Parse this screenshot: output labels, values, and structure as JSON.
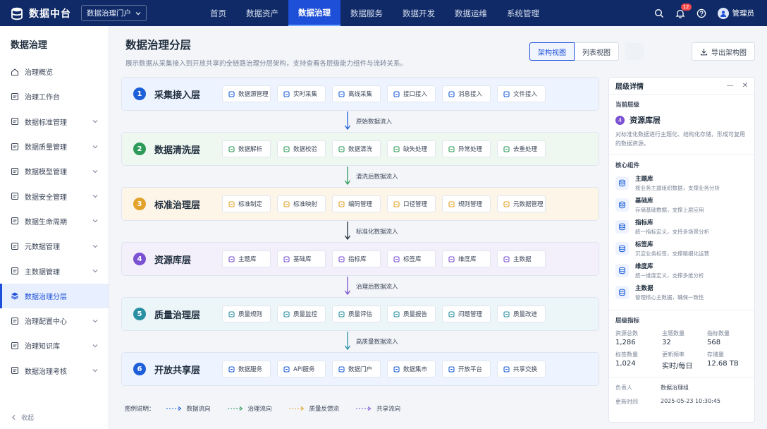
{
  "app": {
    "title": "数据中台",
    "portal": "数据治理门户"
  },
  "nav": [
    "首页",
    "数据资产",
    "数据治理",
    "数据服务",
    "数据开发",
    "数据运维",
    "系统管理"
  ],
  "nav_active": 2,
  "header": {
    "notif_count": "12",
    "user": "管理员"
  },
  "sidebar": {
    "title": "数据治理",
    "items": [
      {
        "label": "治理概览",
        "icon": "home-icon",
        "expand": false
      },
      {
        "label": "治理工作台",
        "icon": "workbench-icon",
        "expand": false
      },
      {
        "label": "数据标准管理",
        "icon": "standard-icon",
        "expand": true
      },
      {
        "label": "数据质量管理",
        "icon": "quality-icon",
        "expand": true
      },
      {
        "label": "数据模型管理",
        "icon": "model-icon",
        "expand": true
      },
      {
        "label": "数据安全管理",
        "icon": "security-icon",
        "expand": true
      },
      {
        "label": "数据生命周期",
        "icon": "lifecycle-icon",
        "expand": true
      },
      {
        "label": "元数据管理",
        "icon": "metadata-icon",
        "expand": true
      },
      {
        "label": "主数据管理",
        "icon": "masterdata-icon",
        "expand": true
      },
      {
        "label": "数据治理分层",
        "icon": "layers-icon",
        "expand": false
      },
      {
        "label": "治理配置中心",
        "icon": "config-icon",
        "expand": true
      },
      {
        "label": "治理知识库",
        "icon": "knowledge-icon",
        "expand": true
      },
      {
        "label": "数据治理考核",
        "icon": "assessment-icon",
        "expand": true
      }
    ],
    "active": 9,
    "collapse": "收起"
  },
  "page": {
    "title": "数据治理分层",
    "desc": "展示数据从采集接入到开放共享的全链路治理分层架构，支持查看各层级能力组件与流转关系。",
    "view_arch": "架构视图",
    "view_list": "列表视图",
    "export": "导出架构图"
  },
  "layers": [
    {
      "num": "1",
      "name": "采集接入层",
      "color": "#1d5fd8",
      "bg": "#eef4ff",
      "items": [
        "数据源管理",
        "实时采集",
        "离线采集",
        "接口接入",
        "消息接入",
        "文件接入"
      ]
    },
    {
      "num": "2",
      "name": "数据清洗层",
      "color": "#2e9a5a",
      "bg": "#eef8f1",
      "items": [
        "数据解析",
        "数据校验",
        "数据清洗",
        "缺失处理",
        "异常处理",
        "去重处理"
      ]
    },
    {
      "num": "3",
      "name": "标准治理层",
      "color": "#e3a32a",
      "bg": "#fdf6e8",
      "items": [
        "标准制定",
        "标准映射",
        "编码管理",
        "口径管理",
        "规则管理",
        "元数据管理"
      ]
    },
    {
      "num": "4",
      "name": "资源库层",
      "color": "#7b52d1",
      "bg": "#f3effb",
      "items": [
        "主题库",
        "基础库",
        "指标库",
        "标签库",
        "维度库",
        "主数据"
      ]
    },
    {
      "num": "5",
      "name": "质量治理层",
      "color": "#2b8fa4",
      "bg": "#ecf6f8",
      "items": [
        "质量规则",
        "质量监控",
        "质量评估",
        "质量报告",
        "问题管理",
        "质量改进"
      ]
    },
    {
      "num": "6",
      "name": "开放共享层",
      "color": "#1d5fd8",
      "bg": "#eef4ff",
      "items": [
        "数据服务",
        "API服务",
        "数据门户",
        "数据集市",
        "开放平台",
        "共享交换"
      ]
    }
  ],
  "flows": [
    {
      "label": "原始数据流入",
      "color": "#1d5fd8"
    },
    {
      "label": "清洗后数据流入",
      "color": "#2e9a5a"
    },
    {
      "label": "标准化数据流入",
      "color": "#1f2d3d"
    },
    {
      "label": "治理后数据流入",
      "color": "#7b52d1"
    },
    {
      "label": "高质量数据流入",
      "color": "#2b8fa4"
    }
  ],
  "legend": {
    "title": "图例说明：",
    "items": [
      {
        "label": "数据流向",
        "color": "#1d5fd8"
      },
      {
        "label": "治理流向",
        "color": "#2e9a5a"
      },
      {
        "label": "质量反馈流",
        "color": "#e3a32a"
      },
      {
        "label": "共享流向",
        "color": "#7b52d1"
      }
    ]
  },
  "panel": {
    "title": "层级详情",
    "current_title": "当前层级",
    "current_num": "4",
    "current_name": "资源库层",
    "current_desc": "对标准化数据进行主题化、结构化存储，形成可复用的数据资源。",
    "comp_title": "核心组件",
    "components": [
      {
        "name": "主题库",
        "desc": "按业务主题组织数据，支撑业务分析",
        "icon": "theme-db-icon"
      },
      {
        "name": "基础库",
        "desc": "存储基础数据，支撑上层应用",
        "icon": "base-db-icon"
      },
      {
        "name": "指标库",
        "desc": "统一指标定义，支持多场景分析",
        "icon": "metric-db-icon"
      },
      {
        "name": "标签库",
        "desc": "沉淀业务标签，支撑精细化运营",
        "icon": "tag-db-icon"
      },
      {
        "name": "维度库",
        "desc": "统一维度定义，支撑多维分析",
        "icon": "dimension-db-icon"
      },
      {
        "name": "主数据",
        "desc": "管理核心主数据，确保一致性",
        "icon": "master-db-icon"
      }
    ],
    "metrics_title": "层级指标",
    "metrics": [
      {
        "label": "资源总数",
        "value": "1,286"
      },
      {
        "label": "主题数量",
        "value": "32"
      },
      {
        "label": "指标数量",
        "value": "568"
      },
      {
        "label": "标签数量",
        "value": "1,024"
      },
      {
        "label": "更新频率",
        "value": "实时/每日"
      },
      {
        "label": "存储量",
        "value": "12.68 TB"
      }
    ],
    "owner_label": "负责人",
    "owner": "数据治理组",
    "updated_label": "更新时间",
    "updated": "2025-05-23 10:30:45"
  }
}
